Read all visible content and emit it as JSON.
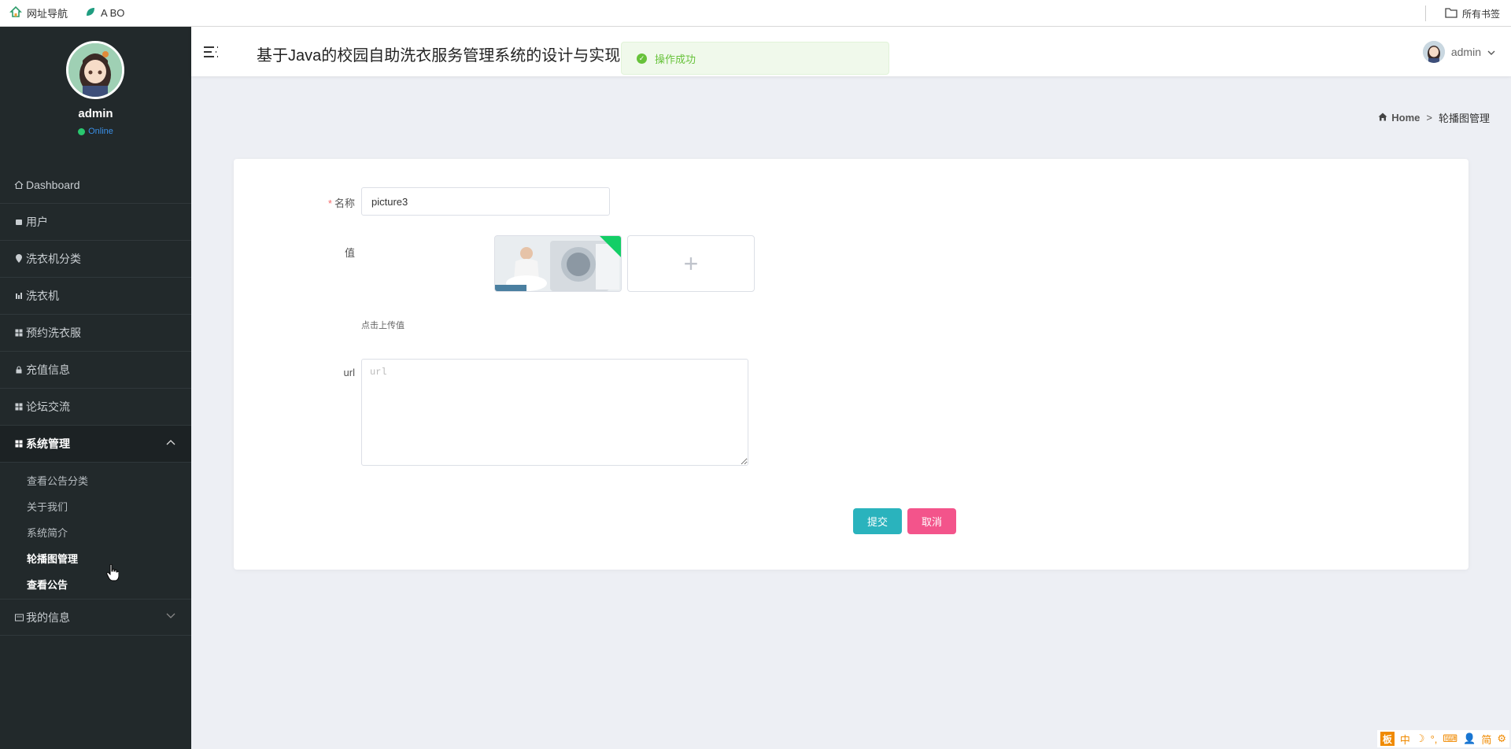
{
  "bookmarks": {
    "items": [
      {
        "label": "网址导航"
      },
      {
        "label": "A BO"
      }
    ],
    "all_label": "所有书签"
  },
  "sidebar": {
    "user_name": "admin",
    "status": "Online",
    "menu": [
      {
        "label": "Dashboard",
        "icon": "home-icon"
      },
      {
        "label": "用户",
        "icon": "square-icon"
      },
      {
        "label": "洗衣机分类",
        "icon": "pin-icon"
      },
      {
        "label": "洗衣机",
        "icon": "bar-icon"
      },
      {
        "label": "预约洗衣服",
        "icon": "grid-icon"
      },
      {
        "label": "充值信息",
        "icon": "lock-icon"
      },
      {
        "label": "论坛交流",
        "icon": "grid-icon"
      },
      {
        "label": "系统管理",
        "icon": "grid-icon",
        "expanded": true
      }
    ],
    "submenu": [
      {
        "label": "查看公告分类"
      },
      {
        "label": "关于我们"
      },
      {
        "label": "系统简介"
      },
      {
        "label": "轮播图管理",
        "active": true
      },
      {
        "label": "查看公告"
      }
    ],
    "last_item": {
      "label": "我的信息",
      "icon": "card-icon"
    }
  },
  "header": {
    "title": "基于Java的校园自助洗衣服务管理系统的设计与实现",
    "toast": "操作成功",
    "user": "admin"
  },
  "breadcrumb": {
    "home": "Home",
    "separator": ">",
    "current": "轮播图管理"
  },
  "form": {
    "name_label": "名称",
    "name_value": "picture3",
    "value_label": "值",
    "upload_tip": "点击上传值",
    "url_label": "url",
    "url_placeholder": "url",
    "submit_label": "提交",
    "cancel_label": "取消"
  },
  "ime": {
    "logo": "板",
    "items": [
      "中",
      "☽",
      "°,",
      "⌨",
      "👤",
      "简",
      "⚙"
    ]
  },
  "colors": {
    "sidebar_bg": "#22292b",
    "submit": "#2ab3bd",
    "cancel": "#f3548b",
    "success": "#67c23a",
    "online": "#29c76f"
  }
}
